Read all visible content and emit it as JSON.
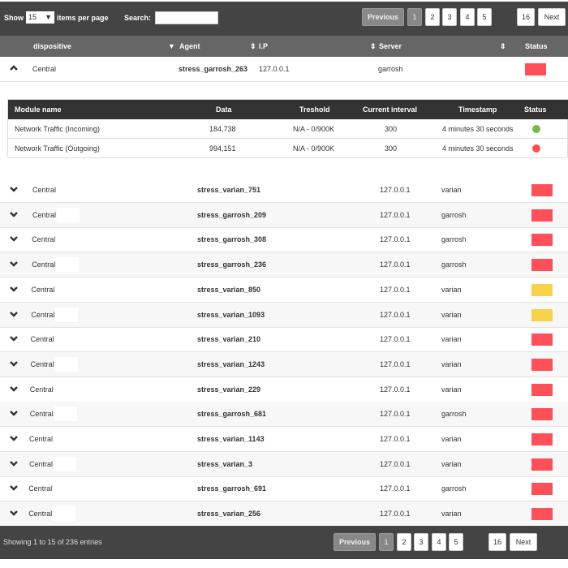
{
  "toolbar": {
    "show_label": "Show",
    "per_page": "15",
    "items_label": "items per page",
    "search_label": "Search:",
    "search_value": ""
  },
  "pagination": {
    "previous": "Previous",
    "pages": [
      "1",
      "2",
      "3",
      "4",
      "5"
    ],
    "last": "16",
    "next": "Next",
    "current": "1"
  },
  "columns": {
    "dispositive": "dispositive",
    "agent": "Agent",
    "ip": "I.P",
    "server": "Server",
    "status": "Status"
  },
  "expanded_row": {
    "dispositive": "Central",
    "agent": "stress_garrosh_263",
    "ip": "127.0.0.1",
    "server": "garrosh",
    "status_color": "#ff4f58"
  },
  "modules": {
    "headers": [
      "Module name",
      "Data",
      "Treshold",
      "Current interval",
      "Timestamp",
      "Status"
    ],
    "rows": [
      {
        "name": "Network Traffic (Incoming)",
        "data": "184,738",
        "threshold": "N/A - 0/900K",
        "interval": "300",
        "timestamp": "4 minutes 30 seconds",
        "status_color": "#7ab648"
      },
      {
        "name": "Network Traffic (Outgoing)",
        "data": "994,151",
        "threshold": "N/A - 0/900K",
        "interval": "300",
        "timestamp": "4 minutes 30 seconds",
        "status_color": "#ff4f58"
      }
    ]
  },
  "rows": [
    {
      "dispositive": "Central",
      "agent": "stress_varian_751",
      "ip": "127.0.0.1",
      "server": "varian",
      "status_color": "#ff4f58"
    },
    {
      "dispositive": "Central",
      "agent": "stress_garrosh_209",
      "ip": "127.0.0.1",
      "server": "garrosh",
      "status_color": "#ff4f58"
    },
    {
      "dispositive": "Central",
      "agent": "stress_garrosh_308",
      "ip": "127.0.0.1",
      "server": "garrosh",
      "status_color": "#ff4f58"
    },
    {
      "dispositive": "Central",
      "agent": "stress_garrosh_236",
      "ip": "127.0.0.1",
      "server": "garrosh",
      "status_color": "#ff4f58"
    },
    {
      "dispositive": "Central",
      "agent": "stress_varian_850",
      "ip": "127.0.0.1",
      "server": "varian",
      "status_color": "#f8d24a"
    },
    {
      "dispositive": "Central",
      "agent": "stress_varian_1093",
      "ip": "127.0.0.1",
      "server": "varian",
      "status_color": "#f8d24a"
    },
    {
      "dispositive": "Central",
      "agent": "stress_varian_210",
      "ip": "127.0.0.1",
      "server": "varian",
      "status_color": "#ff4f58"
    },
    {
      "dispositive": "Central",
      "agent": "stress_varian_1243",
      "ip": "127.0.0.1",
      "server": "varian",
      "status_color": "#ff4f58"
    },
    {
      "dispositive": "Central",
      "agent": "stress_varian_229",
      "ip": "127.0.0.1",
      "server": "varian",
      "status_color": "#ff4f58"
    },
    {
      "dispositive": "Central",
      "agent": "stress_garrosh_681",
      "ip": "127.0.0.1",
      "server": "garrosh",
      "status_color": "#ff4f58"
    },
    {
      "dispositive": "Central",
      "agent": "stress_varian_1143",
      "ip": "127.0.0.1",
      "server": "varian",
      "status_color": "#ff4f58"
    },
    {
      "dispositive": "Central",
      "agent": "stress_varian_3",
      "ip": "127.0.0.1",
      "server": "varian",
      "status_color": "#ff4f58"
    },
    {
      "dispositive": "Central",
      "agent": "stress_garrosh_691",
      "ip": "127.0.0.1",
      "server": "garrosh",
      "status_color": "#ff4f58"
    },
    {
      "dispositive": "Central",
      "agent": "stress_varian_256",
      "ip": "127.0.0.1",
      "server": "varian",
      "status_color": "#ff4f58"
    }
  ],
  "footer": {
    "info": "Showing 1 to 15 of 236 entries"
  }
}
